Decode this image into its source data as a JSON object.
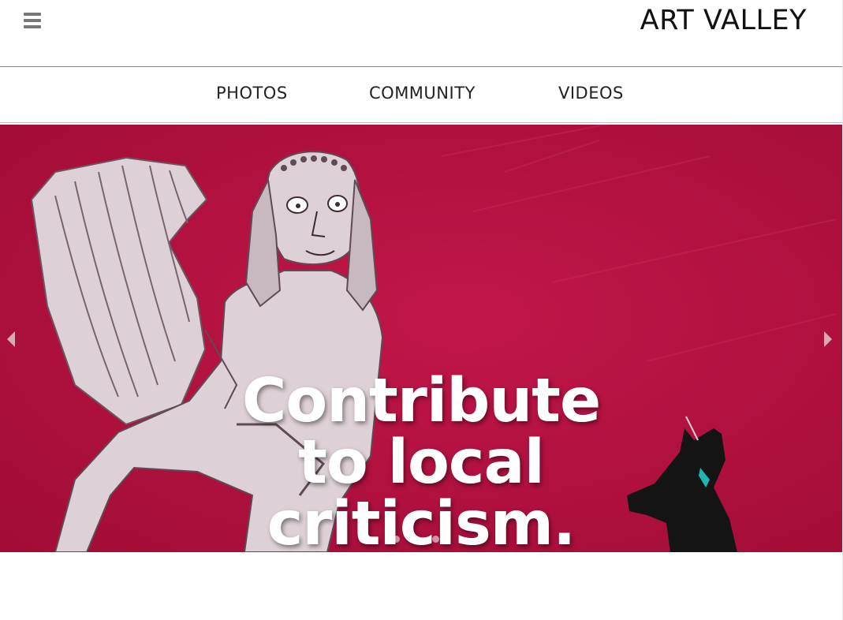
{
  "header": {
    "brand": "ART VALLEY",
    "menu_icon": "hamburger-menu-icon"
  },
  "nav": {
    "items": [
      {
        "label": "PHOTOS"
      },
      {
        "label": "COMMUNITY"
      },
      {
        "label": "VIDEOS"
      }
    ]
  },
  "hero": {
    "headline_lines": [
      "Contribute",
      "to local",
      "criticism."
    ],
    "prev_icon": "chevron-left-icon",
    "next_icon": "chevron-right-icon",
    "slide_count": 3,
    "active_slide": 2,
    "colors": {
      "background": "#b3113d",
      "figure": "#ddd0d6",
      "figure_line": "#5f4a55",
      "silhouette": "#141414",
      "accent": "#1fb5b0"
    }
  }
}
